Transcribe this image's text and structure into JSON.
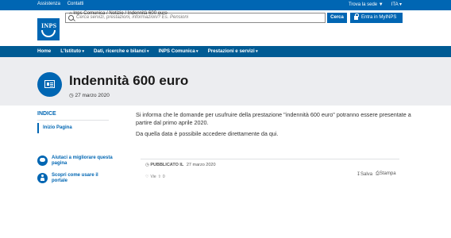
{
  "topbar": {
    "links": [
      "Assistenza",
      "Contatti"
    ],
    "sede_label": "Trova la sede",
    "language": "ITA"
  },
  "header": {
    "logo_text": "INPS",
    "search_placeholder": "Cerca servizi, prestazioni, informazioni? Es. Pensioni",
    "search_button": "Cerca",
    "login_button": "Entra in MyINPS"
  },
  "nav": {
    "items": [
      {
        "label": "Home"
      },
      {
        "label": "L'Istituto"
      },
      {
        "label": "Dati, ricerche e bilanci"
      },
      {
        "label": "INPS Comunica"
      },
      {
        "label": "Prestazioni e servizi"
      }
    ]
  },
  "hero": {
    "breadcrumb": "Inps Comunica / Notizie / Indennità 600 euro",
    "title": "Indennità 600 euro",
    "date": "27 marzo 2020"
  },
  "sidebar": {
    "indice_title": "INDICE",
    "indice_item": "Inizio Pagina",
    "aiuti": [
      {
        "label": "Aiutaci a migliorare questa pagina",
        "icon": "chat-bubble-icon"
      },
      {
        "label": "Scopri come usare il portale",
        "icon": "person-icon"
      }
    ]
  },
  "content": {
    "paragraph1": "Si informa che le domande per usufruire della prestazione \"indennità 600 euro\" potranno essere presentate a partire dal primo aprile 2020.",
    "paragraph2": "Da quella data è possibile accedere direttamente da qui."
  },
  "footer_meta": {
    "published_label": "PUBBLICATO IL",
    "published_date": "27 marzo 2020",
    "save_label": "Salva",
    "print_label": "Stampa",
    "views_label": "Vie",
    "share_count": "0"
  },
  "colors": {
    "primary": "#0066b3",
    "nav": "#005b94",
    "hero_bg": "#ecedf0"
  }
}
